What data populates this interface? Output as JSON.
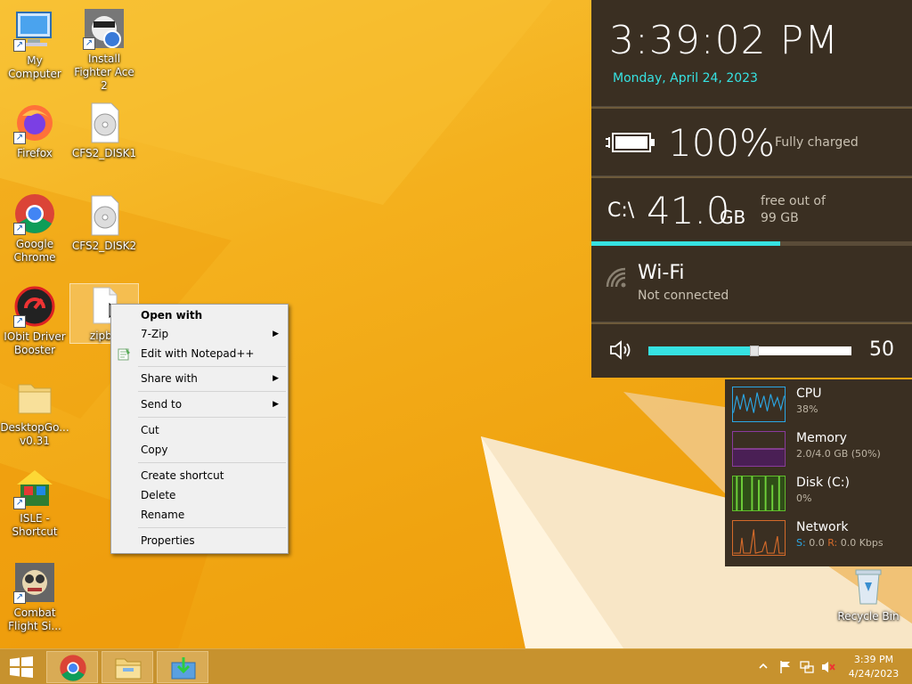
{
  "desktop": {
    "icons": [
      {
        "label": "My Computer"
      },
      {
        "label": "Install Fighter Ace 2"
      },
      {
        "label": "Firefox"
      },
      {
        "label": "CFS2_DISK1"
      },
      {
        "label": "Google Chrome"
      },
      {
        "label": "CFS2_DISK2"
      },
      {
        "label": "IObit Driver Booster"
      },
      {
        "label": "zipbo"
      },
      {
        "label": "DesktopGo... v0.31"
      },
      {
        "label": "ISLE - Shortcut"
      },
      {
        "label": "Combat Flight Si..."
      },
      {
        "label": "Recycle Bin"
      }
    ]
  },
  "context_menu": {
    "items": [
      {
        "label": "Open with",
        "bold": true
      },
      {
        "label": "7-Zip",
        "submenu": true
      },
      {
        "label": "Edit with Notepad++"
      },
      {
        "label": "Share with",
        "submenu": true
      },
      {
        "label": "Send to",
        "submenu": true
      },
      {
        "label": "Cut"
      },
      {
        "label": "Copy"
      },
      {
        "label": "Create shortcut"
      },
      {
        "label": "Delete"
      },
      {
        "label": "Rename"
      },
      {
        "label": "Properties"
      }
    ]
  },
  "gadget": {
    "time": "3:39:02 PM",
    "date": "Monday, April 24, 2023",
    "battery": {
      "percent": "100%",
      "status": "Fully charged"
    },
    "disk": {
      "drive": "C:\\",
      "free": "41.0",
      "unit": "GB",
      "text1": "free out of",
      "text2": "99 GB",
      "used_fraction": 0.59
    },
    "wifi": {
      "title": "Wi-Fi",
      "status": "Not connected"
    },
    "volume": {
      "level": 50,
      "label": "50"
    }
  },
  "perf": {
    "cpu": {
      "label": "CPU",
      "value": "38%"
    },
    "memory": {
      "label": "Memory",
      "value": "2.0/4.0 GB (50%)"
    },
    "disk": {
      "label": "Disk (C:)",
      "value": "0%"
    },
    "network": {
      "label": "Network",
      "s_label": "S:",
      "s_value": "0.0",
      "r_label": "R:",
      "r_value": "0.0 Kbps"
    }
  },
  "taskbar": {
    "clock_time": "3:39 PM",
    "clock_date": "4/24/2023"
  },
  "colors": {
    "accent": "#36e2e2",
    "cpu": "#2aa7e6",
    "memory": "#8a3a9e",
    "disk": "#5fbf2a",
    "network": "#d46a2a"
  }
}
